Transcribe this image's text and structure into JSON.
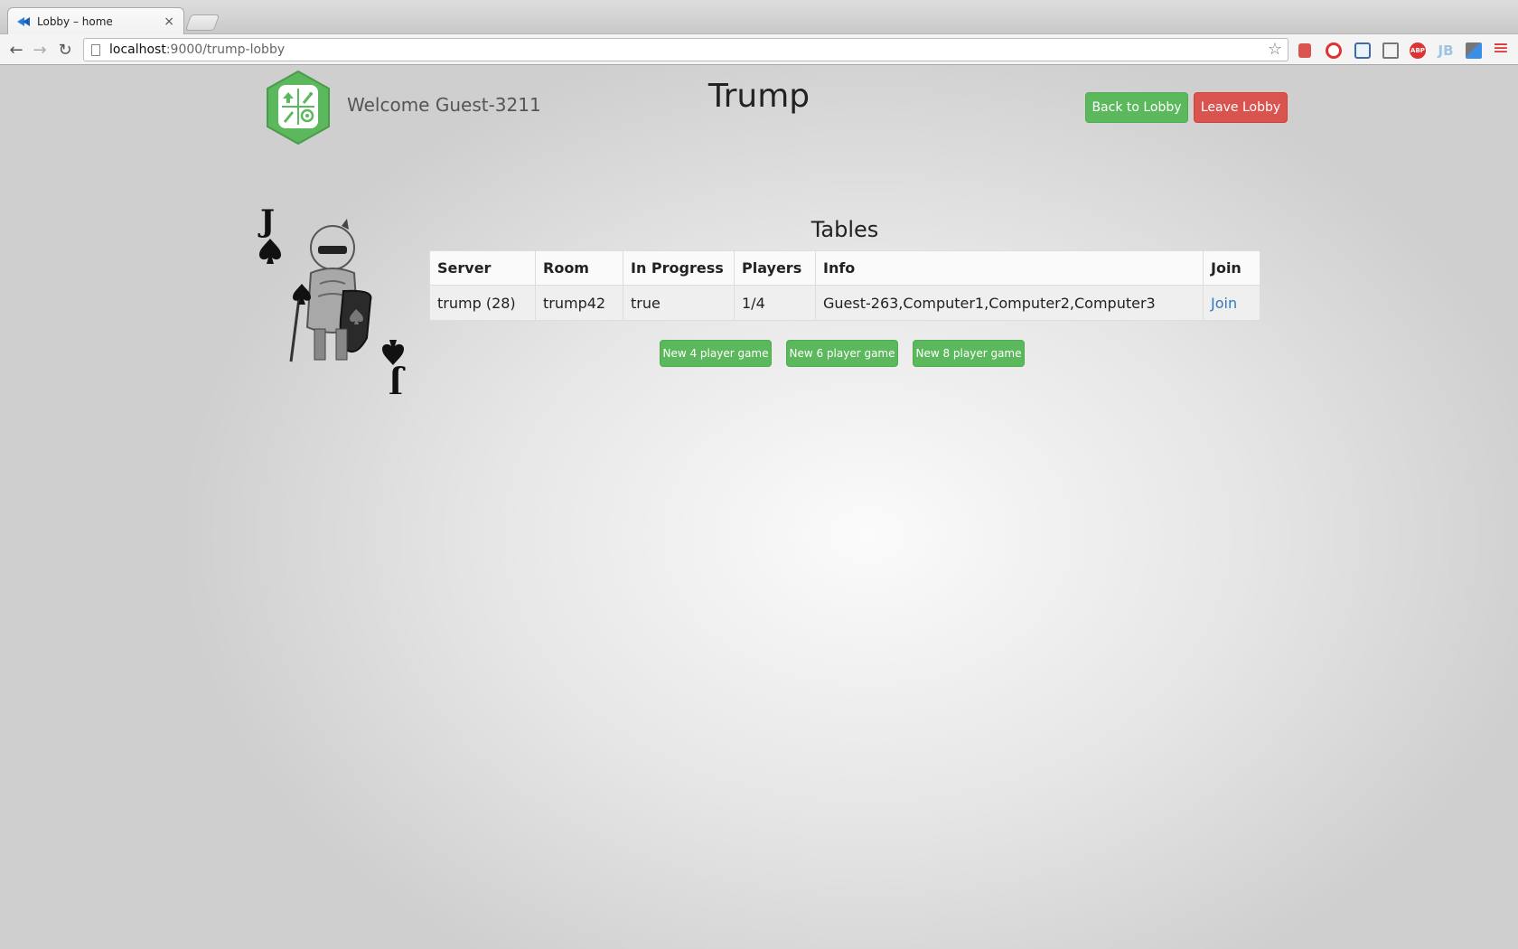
{
  "browser": {
    "tab_title": "Lobby – home",
    "tab_close": "×",
    "url_host": "localhost",
    "url_path": ":9000/trump-lobby",
    "back_icon": "←",
    "forward_icon": "→",
    "reload_icon": "↻",
    "star_icon": "☆",
    "abp_label": "ABP",
    "jb_label": "JB",
    "menu_icon": "≡"
  },
  "header": {
    "welcome": "Welcome Guest-3211",
    "title": "Trump",
    "back_button": "Back to Lobby",
    "leave_button": "Leave Lobby"
  },
  "tables": {
    "title": "Tables",
    "columns": [
      "Server",
      "Room",
      "In Progress",
      "Players",
      "Info",
      "Join"
    ],
    "rows": [
      {
        "server": "trump (28)",
        "room": "trump42",
        "in_progress": "true",
        "players": "1/4",
        "info": "Guest-263,Computer1,Computer2,Computer3",
        "join": "Join"
      }
    ]
  },
  "actions": {
    "new4": "New 4 player game",
    "new6": "New 6 player game",
    "new8": "New 8 player game"
  },
  "colors": {
    "success": "#5cb85c",
    "danger": "#d9534f",
    "link": "#337ab7",
    "logo_green": "#5cb85c"
  }
}
